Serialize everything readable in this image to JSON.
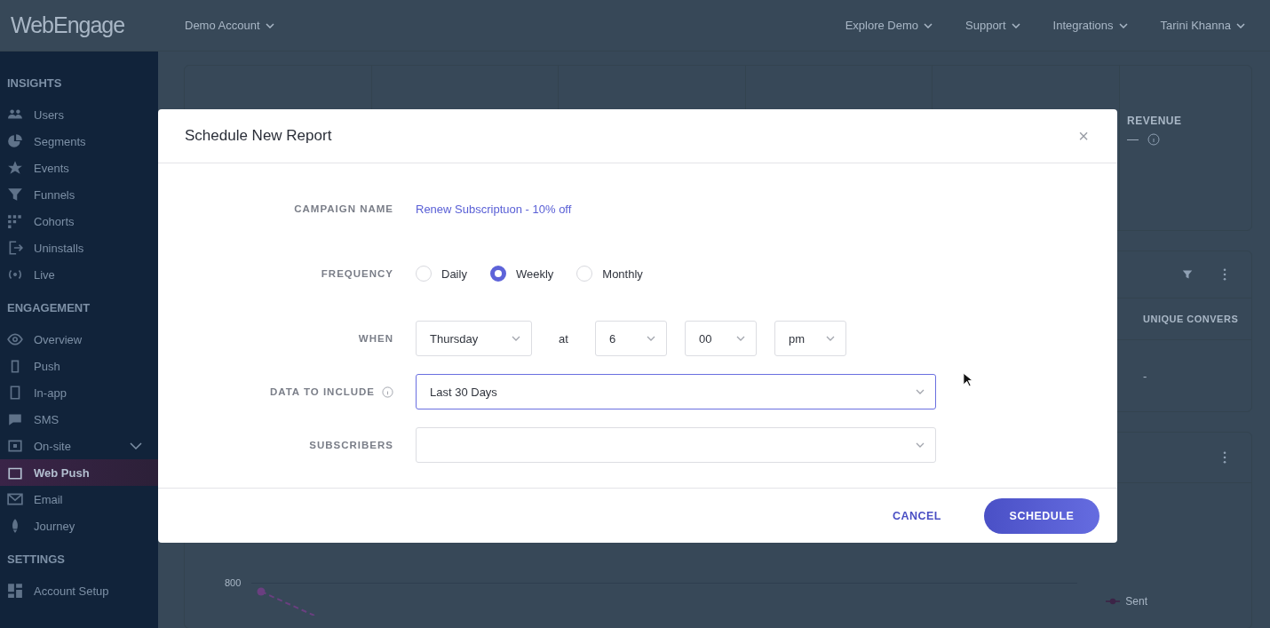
{
  "topbar": {
    "logo": "WebEngage",
    "account": "Demo Account",
    "menus": [
      "Explore Demo",
      "Support",
      "Integrations",
      "Tarini Khanna"
    ]
  },
  "sidebar": {
    "sections": [
      {
        "title": "INSIGHTS",
        "items": [
          {
            "label": "Users",
            "kind": "link",
            "selected": false
          },
          {
            "label": "Segments",
            "kind": "link",
            "selected": false
          },
          {
            "label": "Events",
            "kind": "link",
            "selected": false
          },
          {
            "label": "Funnels",
            "kind": "link",
            "selected": false
          },
          {
            "label": "Cohorts",
            "kind": "link",
            "selected": false
          },
          {
            "label": "Uninstalls",
            "kind": "link",
            "selected": false
          },
          {
            "label": "Live",
            "kind": "link",
            "selected": false
          }
        ]
      },
      {
        "title": "ENGAGEMENT",
        "items": [
          {
            "label": "Overview",
            "kind": "link",
            "selected": false
          },
          {
            "label": "Push",
            "kind": "link",
            "selected": false
          },
          {
            "label": "In-app",
            "kind": "link",
            "selected": false
          },
          {
            "label": "SMS",
            "kind": "link",
            "selected": false
          },
          {
            "label": "On-site",
            "kind": "group",
            "selected": false,
            "expanded": false
          },
          {
            "label": "Web Push",
            "kind": "link",
            "selected": true
          },
          {
            "label": "Email",
            "kind": "link",
            "selected": false
          },
          {
            "label": "Journey",
            "kind": "link",
            "selected": false
          }
        ]
      },
      {
        "title": "SETTINGS",
        "items": [
          {
            "label": "Account Setup",
            "kind": "link",
            "selected": false
          }
        ]
      }
    ]
  },
  "background": {
    "metric_label": "REVENUE",
    "metric_value": "—",
    "table_header": "UNIQUE CONVERS",
    "table_cell": "-",
    "chart_tick": "800",
    "chart_legend": "Sent"
  },
  "modal": {
    "title": "Schedule New Report",
    "close": "×",
    "campaign_name": {
      "label": "CAMPAIGN NAME",
      "value": "Renew Subscriptuon - 10% off"
    },
    "frequency": {
      "label": "FREQUENCY",
      "options": [
        {
          "label": "Daily",
          "selected": false
        },
        {
          "label": "Weekly",
          "selected": true
        },
        {
          "label": "Monthly",
          "selected": false
        }
      ]
    },
    "when": {
      "label": "WHEN",
      "connector": "at",
      "selects": [
        {
          "value": "Thursday",
          "focused": false
        },
        {
          "value": "6",
          "focused": false
        },
        {
          "value": "00",
          "focused": false
        },
        {
          "value": "pm",
          "focused": false
        }
      ]
    },
    "data_to_include": {
      "label": "DATA TO INCLUDE",
      "value": "Last 30 Days",
      "focused": true
    },
    "subscribers": {
      "label": "SUBSCRIBERS",
      "focused": false
    },
    "buttons": {
      "cancel": "CANCEL",
      "submit": "SCHEDULE"
    }
  }
}
